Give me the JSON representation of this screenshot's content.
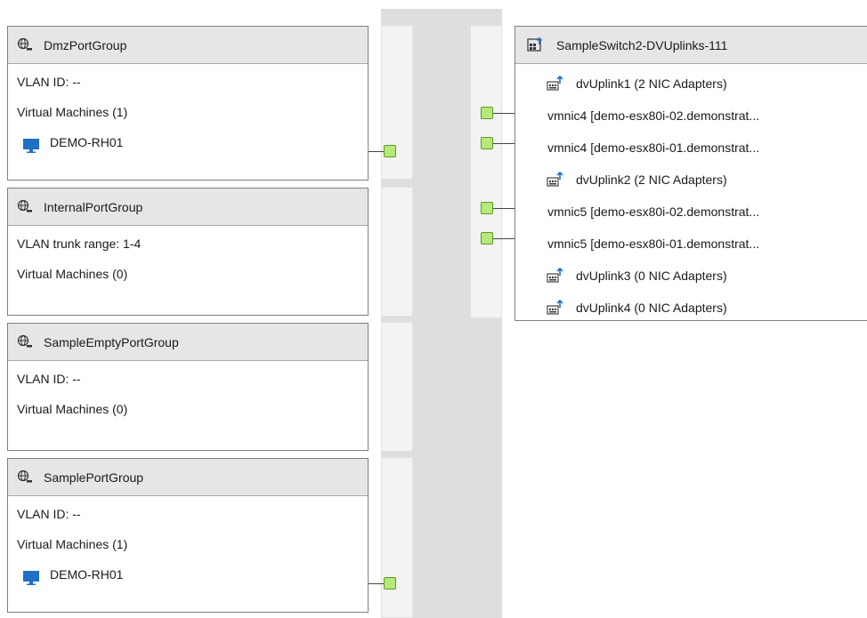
{
  "port_groups": [
    {
      "name": "DmzPortGroup",
      "vlan": "VLAN ID: --",
      "vms_label": "Virtual Machines (1)",
      "vms": [
        "DEMO-RH01"
      ]
    },
    {
      "name": "InternalPortGroup",
      "vlan": "VLAN trunk range: 1-4",
      "vms_label": "Virtual Machines (0)",
      "vms": []
    },
    {
      "name": "SampleEmptyPortGroup",
      "vlan": "VLAN ID: --",
      "vms_label": "Virtual Machines (0)",
      "vms": []
    },
    {
      "name": "SamplePortGroup",
      "vlan": "VLAN ID: --",
      "vms_label": "Virtual Machines (1)",
      "vms": [
        "DEMO-RH01"
      ]
    }
  ],
  "uplink_group": {
    "name": "SampleSwitch2-DVUplinks-111",
    "uplinks": [
      {
        "label": "dvUplink1 (2 NIC Adapters)",
        "nics": [
          "vmnic4 [demo-esx80i-02.demonstrat...",
          "vmnic4 [demo-esx80i-01.demonstrat..."
        ]
      },
      {
        "label": "dvUplink2 (2 NIC Adapters)",
        "nics": [
          "vmnic5 [demo-esx80i-02.demonstrat...",
          "vmnic5 [demo-esx80i-01.demonstrat..."
        ]
      },
      {
        "label": "dvUplink3 (0 NIC Adapters)",
        "nics": []
      },
      {
        "label": "dvUplink4 (0 NIC Adapters)",
        "nics": []
      }
    ]
  },
  "colors": {
    "port_fill": "#b6e87a",
    "port_border": "#5d9a2a",
    "vm_icon": "#1f6fc5",
    "header_bg": "#e6e6e6"
  },
  "icons": {
    "port_group": "globe-network-icon",
    "vm": "monitor-icon",
    "uplink_group": "uplink-group-icon",
    "uplink": "uplink-icon"
  }
}
